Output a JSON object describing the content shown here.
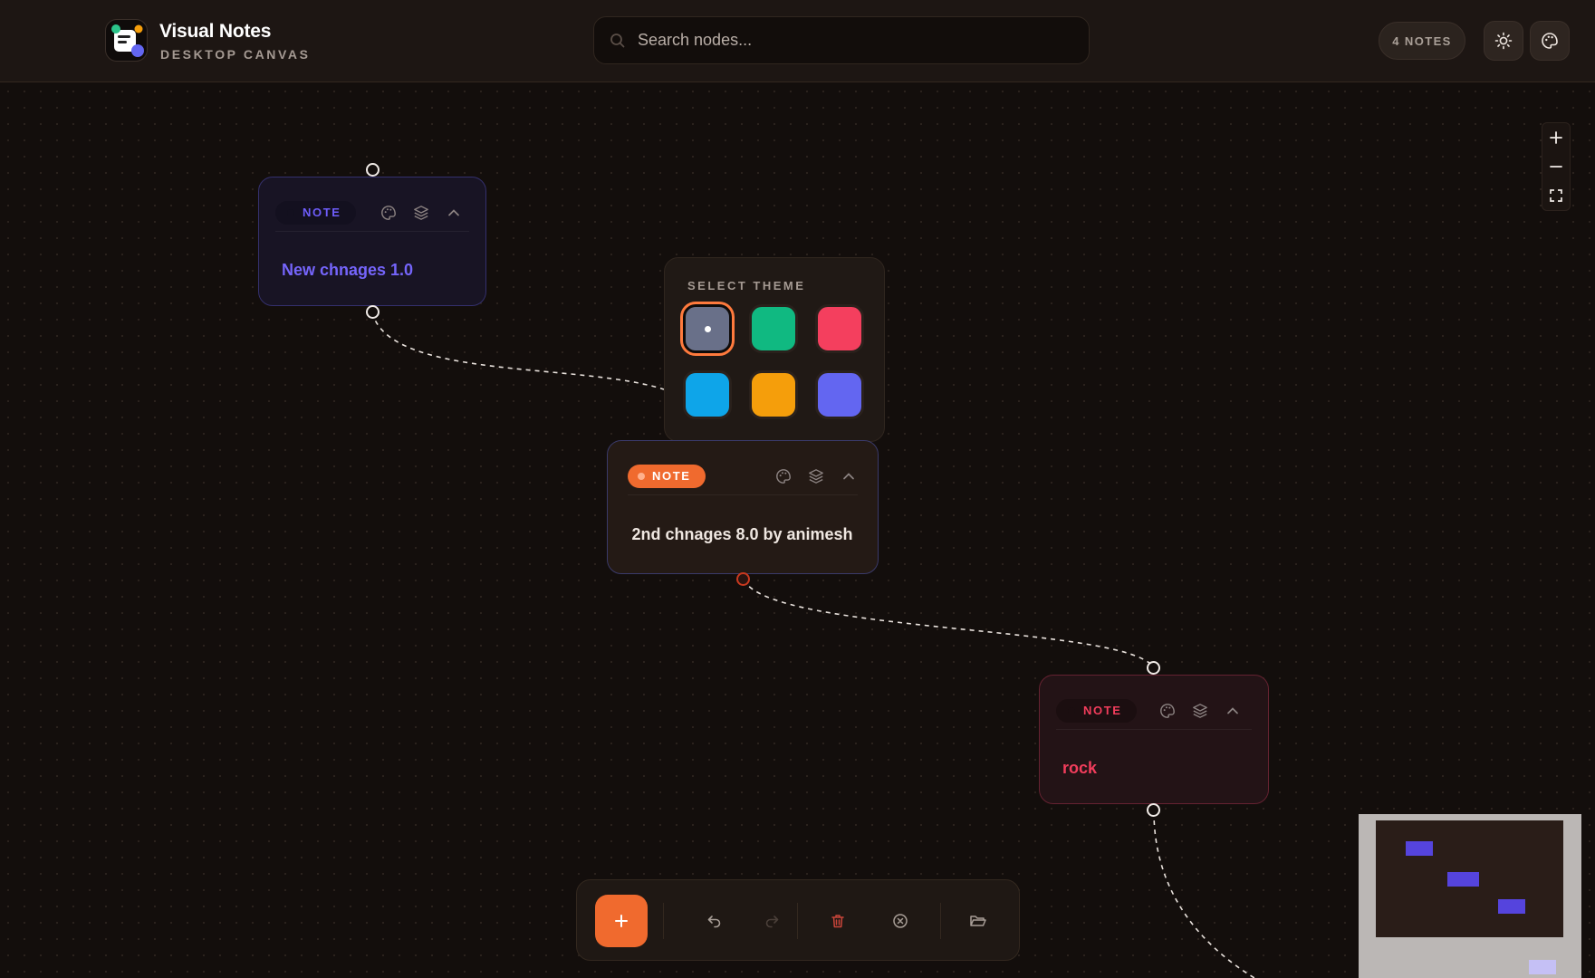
{
  "app": {
    "title": "Visual Notes",
    "subtitle": "DESKTOP CANVAS"
  },
  "search": {
    "placeholder": "Search nodes...",
    "value": ""
  },
  "header": {
    "notes_count_label": "4 NOTES",
    "theme_toggle_icon": "sun-icon",
    "palette_icon": "palette-icon"
  },
  "zoom_controls": {
    "zoom_in_icon": "plus-icon",
    "zoom_out_icon": "minus-icon",
    "fit_view_icon": "fullscreen-icon"
  },
  "theme_picker": {
    "title": "SELECT THEME",
    "swatches": [
      {
        "name": "slate",
        "color": "#697089",
        "selected": true
      },
      {
        "name": "emerald",
        "color": "#10b981",
        "selected": false
      },
      {
        "name": "rose",
        "color": "#f43f5e",
        "selected": false
      },
      {
        "name": "sky",
        "color": "#0ea5e9",
        "selected": false
      },
      {
        "name": "amber",
        "color": "#f59e0b",
        "selected": false
      },
      {
        "name": "indigo",
        "color": "#6366f1",
        "selected": false
      }
    ]
  },
  "nodes": [
    {
      "label": "NOTE",
      "text": "New chnages 1.0",
      "accent": "#6e5dfa"
    },
    {
      "label": "NOTE",
      "text": "2nd chnages 8.0 by animesh",
      "accent": "#f06a2e"
    },
    {
      "label": "NOTE",
      "text": "rock",
      "accent": "#f23d5c"
    }
  ],
  "node_tools": [
    "palette-icon",
    "layers-icon",
    "chevron-up-icon"
  ],
  "toolbar": {
    "add_icon": "plus-icon",
    "undo_icon": "undo-icon",
    "redo_icon": "redo-icon",
    "delete_icon": "trash-icon",
    "clear_icon": "close-circle-icon",
    "open_icon": "folder-open-icon"
  },
  "colors": {
    "background": "#130e0c",
    "accent": "#f06a2e"
  }
}
